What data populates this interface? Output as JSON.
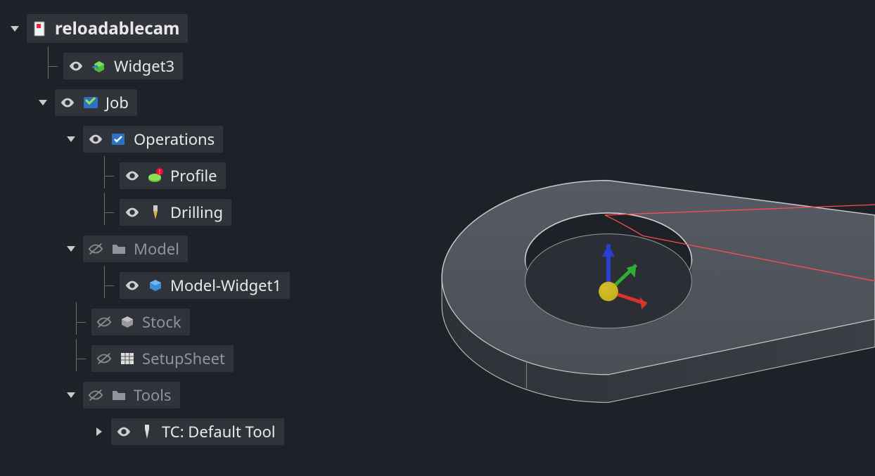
{
  "tree": {
    "root": {
      "label": "reloadablecam"
    },
    "widget3": {
      "label": "Widget3"
    },
    "job": {
      "label": "Job"
    },
    "operations": {
      "label": "Operations"
    },
    "profile": {
      "label": "Profile"
    },
    "drilling": {
      "label": "Drilling"
    },
    "model": {
      "label": "Model"
    },
    "modelwidget": {
      "label": "Model-Widget1"
    },
    "stock": {
      "label": "Stock"
    },
    "setupsheet": {
      "label": "SetupSheet"
    },
    "tools": {
      "label": "Tools"
    },
    "defaulttool": {
      "label": "TC: Default Tool"
    }
  }
}
